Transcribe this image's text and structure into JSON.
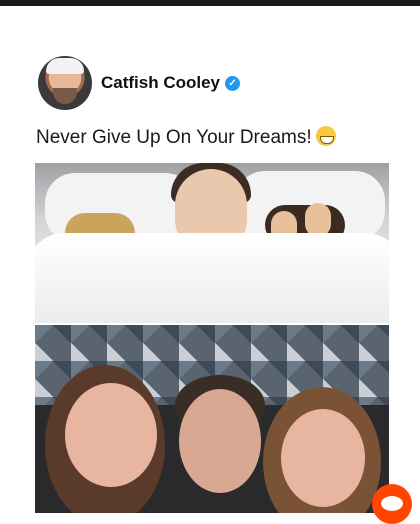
{
  "post": {
    "author_name": "Catfish Cooley",
    "text": "Never Give Up On Your Dreams!"
  },
  "icons": {
    "verified": "verified-badge-icon",
    "emoji": "grinning-face-emoji",
    "reddit": "reddit-snoo-icon"
  },
  "colors": {
    "verified_badge": "#1d9bf0",
    "reddit_brand": "#ff4500",
    "text": "#111111"
  }
}
